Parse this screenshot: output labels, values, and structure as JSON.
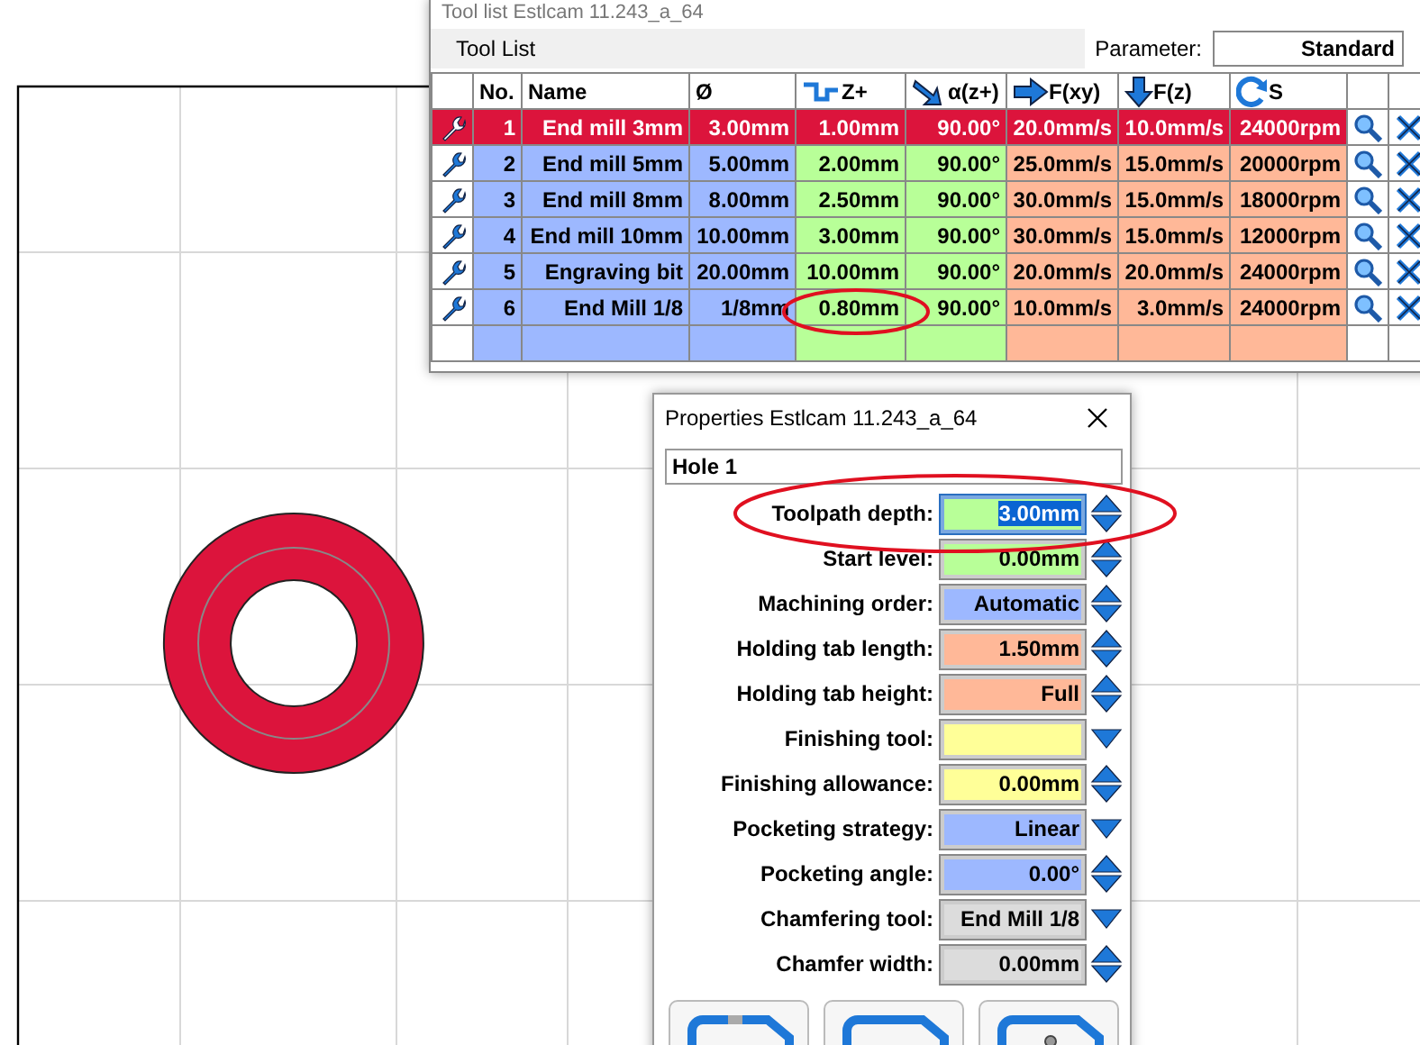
{
  "tool_list_window": {
    "title": "Tool list Estlcam 11.243_a_64",
    "toolbar_label": "Tool List",
    "parameter_label": "Parameter:",
    "parameter_value": "Standard",
    "columns": [
      {
        "label": "No."
      },
      {
        "label": "Name"
      },
      {
        "label": "Ø"
      },
      {
        "label": "Z+"
      },
      {
        "label": "α(z+)"
      },
      {
        "label": "F(xy)"
      },
      {
        "label": "F(z)"
      },
      {
        "label": "S"
      }
    ],
    "rows": [
      {
        "selected": true,
        "cells": [
          "1",
          "End mill 3mm",
          "3.00mm",
          "1.00mm",
          "90.00°",
          "20.0mm/s",
          "10.0mm/s",
          "24000rpm"
        ]
      },
      {
        "selected": false,
        "cells": [
          "2",
          "End mill 5mm",
          "5.00mm",
          "2.00mm",
          "90.00°",
          "25.0mm/s",
          "15.0mm/s",
          "20000rpm"
        ]
      },
      {
        "selected": false,
        "cells": [
          "3",
          "End mill 8mm",
          "8.00mm",
          "2.50mm",
          "90.00°",
          "30.0mm/s",
          "15.0mm/s",
          "18000rpm"
        ]
      },
      {
        "selected": false,
        "cells": [
          "4",
          "End mill 10mm",
          "10.00mm",
          "3.00mm",
          "90.00°",
          "30.0mm/s",
          "15.0mm/s",
          "12000rpm"
        ]
      },
      {
        "selected": false,
        "cells": [
          "5",
          "Engraving bit",
          "20.00mm",
          "10.00mm",
          "90.00°",
          "20.0mm/s",
          "20.0mm/s",
          "24000rpm"
        ]
      },
      {
        "selected": false,
        "cells": [
          "6",
          "End Mill 1/8",
          "1/8mm",
          "0.80mm",
          "90.00°",
          "10.0mm/s",
          "3.0mm/s",
          "24000rpm"
        ]
      }
    ]
  },
  "properties_window": {
    "title": "Properties Estlcam 11.243_a_64",
    "name": "Hole 1",
    "fields": [
      {
        "label": "Toolpath depth:",
        "value": "3.00mm",
        "kind": "spin",
        "color": "#b8ff98",
        "selected": true
      },
      {
        "label": "Start level:",
        "value": "0.00mm",
        "kind": "spin",
        "color": "#b8ff98",
        "selected": false
      },
      {
        "label": "Machining order:",
        "value": "Automatic",
        "kind": "spin",
        "color": "#9db8ff",
        "selected": false
      },
      {
        "label": "Holding tab length:",
        "value": "1.50mm",
        "kind": "spin",
        "color": "#ffb898",
        "selected": false
      },
      {
        "label": "Holding tab height:",
        "value": "Full",
        "kind": "spin",
        "color": "#ffb898",
        "selected": false
      },
      {
        "label": "Finishing tool:",
        "kind": "dropdown",
        "color": "#ffff98",
        "selected": false
      },
      {
        "label": "Finishing allowance:",
        "value": "0.00mm",
        "kind": "spin",
        "color": "#ffff98",
        "selected": false
      },
      {
        "label": "Pocketing strategy:",
        "value": "Linear",
        "kind": "dropdown",
        "color": "#9db8ff",
        "selected": false
      },
      {
        "label": "Pocketing angle:",
        "value": "0.00°",
        "kind": "spin",
        "color": "#9db8ff",
        "selected": false
      },
      {
        "label": "Chamfering tool:",
        "value": "End Mill 1/8",
        "kind": "dropdown",
        "color": "#dcdcdc",
        "selected": false
      },
      {
        "label": "Chamfer width:",
        "value": "0.00mm",
        "kind": "spin",
        "color": "#dcdcdc",
        "selected": false
      }
    ],
    "buttons": [
      {
        "kind": "tab"
      },
      {
        "kind": "plain"
      },
      {
        "kind": "pin"
      }
    ]
  }
}
